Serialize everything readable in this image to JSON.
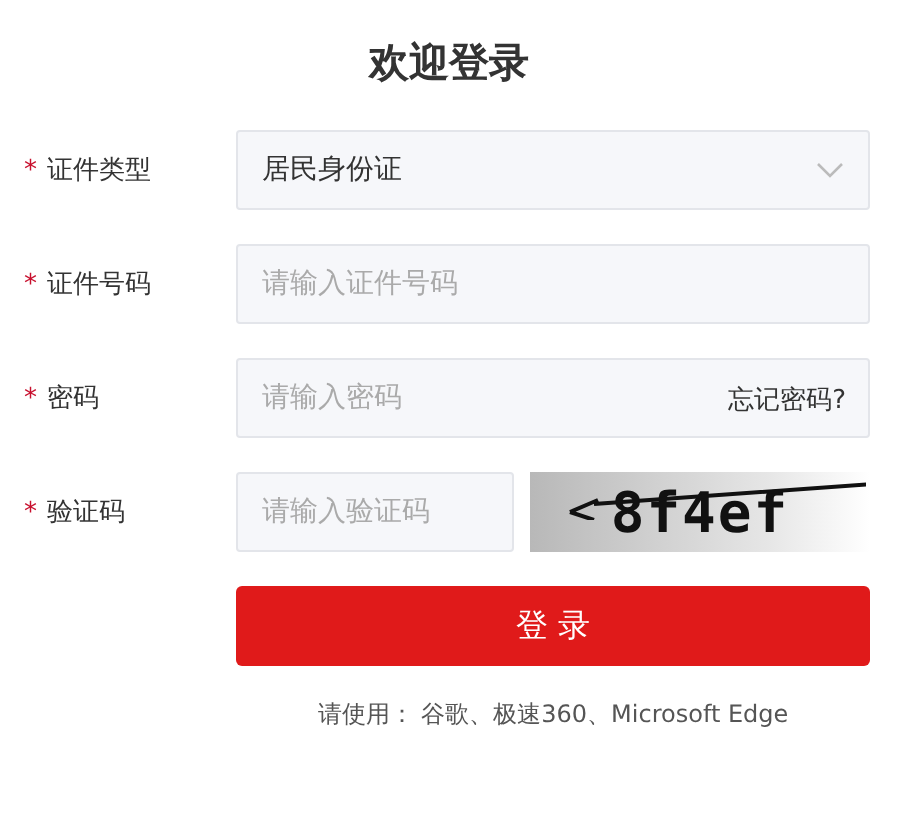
{
  "title": "欢迎登录",
  "fields": [
    {
      "kind": "select",
      "mark": "*",
      "label": "证件类型",
      "value": "居民身份证"
    },
    {
      "kind": "text",
      "mark": "*",
      "label": "证件号码",
      "placeholder": "请输入证件号码"
    },
    {
      "kind": "password",
      "mark": "*",
      "label": "密码",
      "placeholder": "请输入密码",
      "link": "忘记密码?"
    },
    {
      "kind": "captcha",
      "mark": "*",
      "label": "验证码",
      "placeholder": "请输入验证码",
      "captcha": "8f4ef"
    }
  ],
  "submit": "登 录",
  "footer": "请使用： 谷歌、极速360、Microsoft Edge"
}
